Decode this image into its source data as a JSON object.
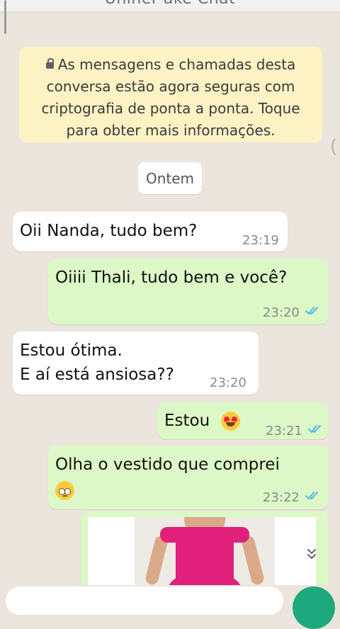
{
  "header": {
    "watermark": "Uniner ake Chat"
  },
  "encryption_notice": {
    "lines": [
      "As mensagens e chamadas desta",
      "conversa estão agora seguras com",
      "criptografia de ponta a ponta. Toque",
      "para obter mais informações."
    ]
  },
  "date_divider": "Ontem",
  "messages": [
    {
      "direction": "in",
      "lines": [
        "Oii Nanda, tudo bem?"
      ],
      "time": "23:19"
    },
    {
      "direction": "out",
      "lines": [
        "Oiiii Thali, tudo bem e você?"
      ],
      "time": "23:20",
      "read": true
    },
    {
      "direction": "in",
      "lines": [
        "Estou ótima.",
        "E aí está ansiosa??"
      ],
      "time": "23:20"
    },
    {
      "direction": "out",
      "lines": [
        "Estou"
      ],
      "emoji": "smiling-face-with-heart-eyes",
      "time": "23:21",
      "read": true
    },
    {
      "direction": "out",
      "lines": [
        "Olha o vestido que comprei"
      ],
      "emoji": "pleading-face",
      "time": "23:22",
      "read": true
    }
  ],
  "image_message": {
    "subject": "pink-off-shoulder-dress",
    "direction": "out"
  },
  "colors": {
    "background": "#ECE5DD",
    "incoming_bubble": "#FFFFFF",
    "outgoing_bubble": "#DCF8C6",
    "notice_bg": "#FCF2C4",
    "read_ticks": "#4FB6EC",
    "accent_green": "#1DA87E"
  }
}
